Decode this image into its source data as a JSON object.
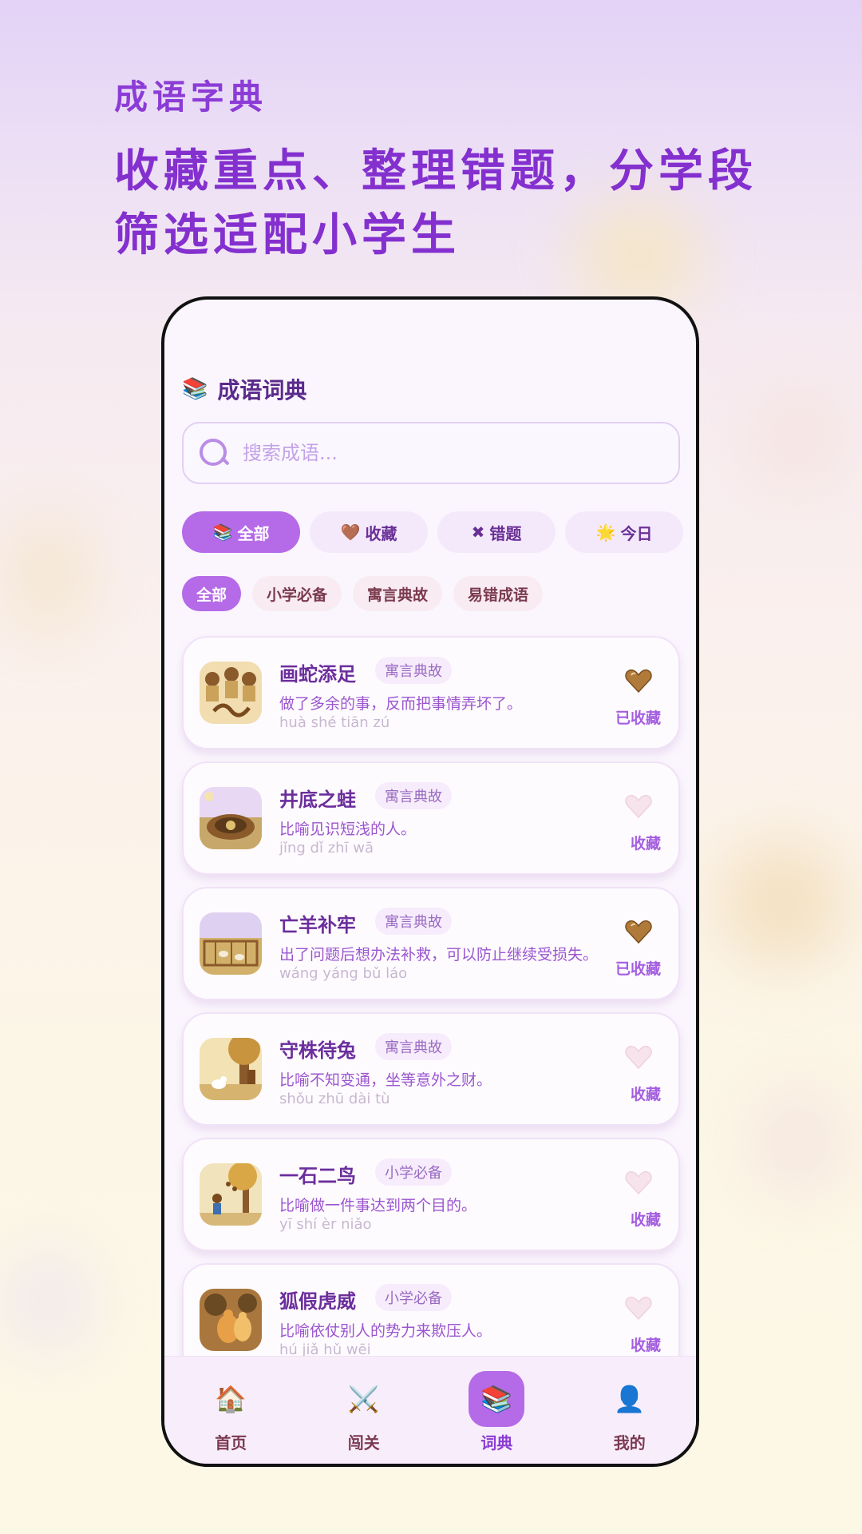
{
  "promo": {
    "subtitle": "成语字典",
    "title": "收藏重点、整理错题，分学段筛选适配小学生"
  },
  "app": {
    "header_icon": "book-stack-icon",
    "title": "成语词典"
  },
  "search": {
    "placeholder": "搜索成语...",
    "value": ""
  },
  "filter_tabs": [
    {
      "icon": "📚",
      "label": "全部",
      "active": true
    },
    {
      "icon": "🤎",
      "label": "收藏",
      "active": false
    },
    {
      "icon": "✖",
      "label": "错题",
      "active": false
    },
    {
      "icon": "🌟",
      "label": "今日",
      "active": false
    }
  ],
  "categories": [
    {
      "label": "全部",
      "active": true
    },
    {
      "label": "小学必备",
      "active": false
    },
    {
      "label": "寓言典故",
      "active": false
    },
    {
      "label": "易错成语",
      "active": false
    }
  ],
  "idioms": [
    {
      "name": "画蛇添足",
      "category": "寓言典故",
      "meaning": "做了多余的事，反而把事情弄坏了。",
      "pinyin": "huà shé tiān zú",
      "favorited": true,
      "fav_label": "已收藏"
    },
    {
      "name": "井底之蛙",
      "category": "寓言典故",
      "meaning": "比喻见识短浅的人。",
      "pinyin": "jǐng dǐ zhī wā",
      "favorited": false,
      "fav_label": "收藏"
    },
    {
      "name": "亡羊补牢",
      "category": "寓言典故",
      "meaning": "出了问题后想办法补救，可以防止继续受损失。",
      "pinyin": "wáng yáng bǔ láo",
      "favorited": true,
      "fav_label": "已收藏"
    },
    {
      "name": "守株待兔",
      "category": "寓言典故",
      "meaning": "比喻不知变通，坐等意外之财。",
      "pinyin": "shǒu zhū dài tù",
      "favorited": false,
      "fav_label": "收藏"
    },
    {
      "name": "一石二鸟",
      "category": "小学必备",
      "meaning": "比喻做一件事达到两个目的。",
      "pinyin": "yī shí èr niǎo",
      "favorited": false,
      "fav_label": "收藏"
    },
    {
      "name": "狐假虎威",
      "category": "小学必备",
      "meaning": "比喻依仗别人的势力来欺压人。",
      "pinyin": "hú jiǎ hǔ wēi",
      "favorited": false,
      "fav_label": "收藏"
    }
  ],
  "bottom_nav": [
    {
      "icon": "🏠",
      "label": "首页",
      "active": false
    },
    {
      "icon": "⚔️",
      "label": "闯关",
      "active": false
    },
    {
      "icon": "📚",
      "label": "词典",
      "active": true
    },
    {
      "icon": "👤",
      "label": "我的",
      "active": false
    }
  ],
  "colors": {
    "accent": "#b56ae8",
    "title_purple": "#8430cf",
    "heart_filled": "#b07a3a",
    "heart_empty": "#f3dde8"
  }
}
